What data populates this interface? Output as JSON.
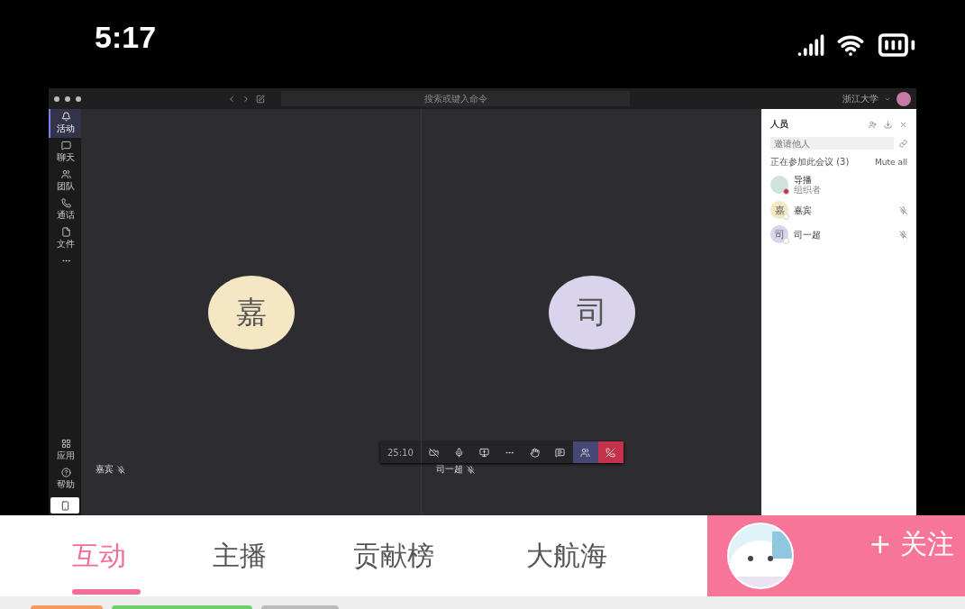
{
  "status_bar": {
    "time": "5:17"
  },
  "meeting": {
    "search": {
      "placeholder": "搜索或键入命令"
    },
    "org": "浙江大学",
    "rail": [
      {
        "label": "活动",
        "selected": true
      },
      {
        "label": "聊天",
        "selected": false
      },
      {
        "label": "团队",
        "selected": false
      },
      {
        "label": "通话",
        "selected": false
      },
      {
        "label": "文件",
        "selected": false
      }
    ],
    "rail_bottom": [
      {
        "label": "应用"
      },
      {
        "label": "帮助"
      }
    ],
    "tiles": [
      {
        "initial": "嘉",
        "name": "嘉宾",
        "color": "#f5e6c4"
      },
      {
        "initial": "司",
        "name": "司一超",
        "color": "#d9d4ec"
      }
    ],
    "controls": {
      "timer": "25:10",
      "buttons": [
        {
          "kind": "camera-off"
        },
        {
          "kind": "mic"
        },
        {
          "kind": "share"
        },
        {
          "kind": "more"
        },
        {
          "kind": "hand"
        },
        {
          "kind": "chat"
        },
        {
          "kind": "people",
          "selected": true
        },
        {
          "kind": "hangup"
        }
      ]
    },
    "people": {
      "title": "人员",
      "invite": {
        "placeholder": "邀请他人"
      },
      "section": "正在参加此会议 (3)",
      "mute_all": "Mute all",
      "members": [
        {
          "name": "导播",
          "role": "组织者",
          "color": "#cfe3dc",
          "busy": true,
          "muted": false
        },
        {
          "initial": "嘉",
          "name": "嘉宾",
          "color": "#f5e6c4",
          "busy": false,
          "muted": true
        },
        {
          "initial": "司",
          "name": "司一超",
          "color": "#d9d4ec",
          "busy": false,
          "muted": true
        }
      ]
    }
  },
  "tabs": [
    {
      "label": "互动",
      "selected": true
    },
    {
      "label": "主播",
      "selected": false
    },
    {
      "label": "贡献榜",
      "selected": false
    },
    {
      "label": "大航海",
      "selected": false
    }
  ],
  "follow": {
    "label": "+ 关注"
  }
}
